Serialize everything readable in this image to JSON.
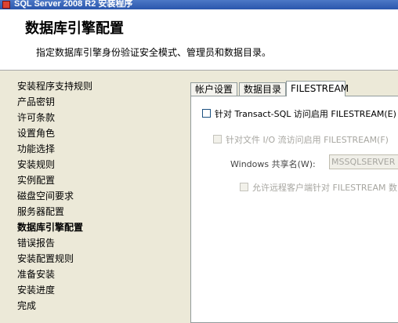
{
  "window": {
    "title": "SQL Server 2008 R2 安装程序"
  },
  "header": {
    "title": "数据库引擎配置",
    "subtitle": "指定数据库引擎身份验证安全模式、管理员和数据目录。"
  },
  "sidebar": {
    "items": [
      {
        "label": "安装程序支持规则"
      },
      {
        "label": "产品密钥"
      },
      {
        "label": "许可条款"
      },
      {
        "label": "设置角色"
      },
      {
        "label": "功能选择"
      },
      {
        "label": "安装规则"
      },
      {
        "label": "实例配置"
      },
      {
        "label": "磁盘空间要求"
      },
      {
        "label": "服务器配置"
      },
      {
        "label": "数据库引擎配置",
        "active": true
      },
      {
        "label": "错误报告"
      },
      {
        "label": "安装配置规则"
      },
      {
        "label": "准备安装"
      },
      {
        "label": "安装进度"
      },
      {
        "label": "完成"
      }
    ]
  },
  "tabs": [
    {
      "label": "帐户设置"
    },
    {
      "label": "数据目录"
    },
    {
      "label": "FILESTREAM",
      "active": true
    }
  ],
  "filestream": {
    "enable_tsql": "针对 Transact-SQL 访问启用 FILESTREAM(E)",
    "enable_io": "针对文件 I/O 流访问启用 FILESTREAM(F)",
    "share_label": "Windows 共享名(W):",
    "share_value": "MSSQLSERVER",
    "allow_remote": "允许远程客户端针对 FILESTREAM 数"
  }
}
